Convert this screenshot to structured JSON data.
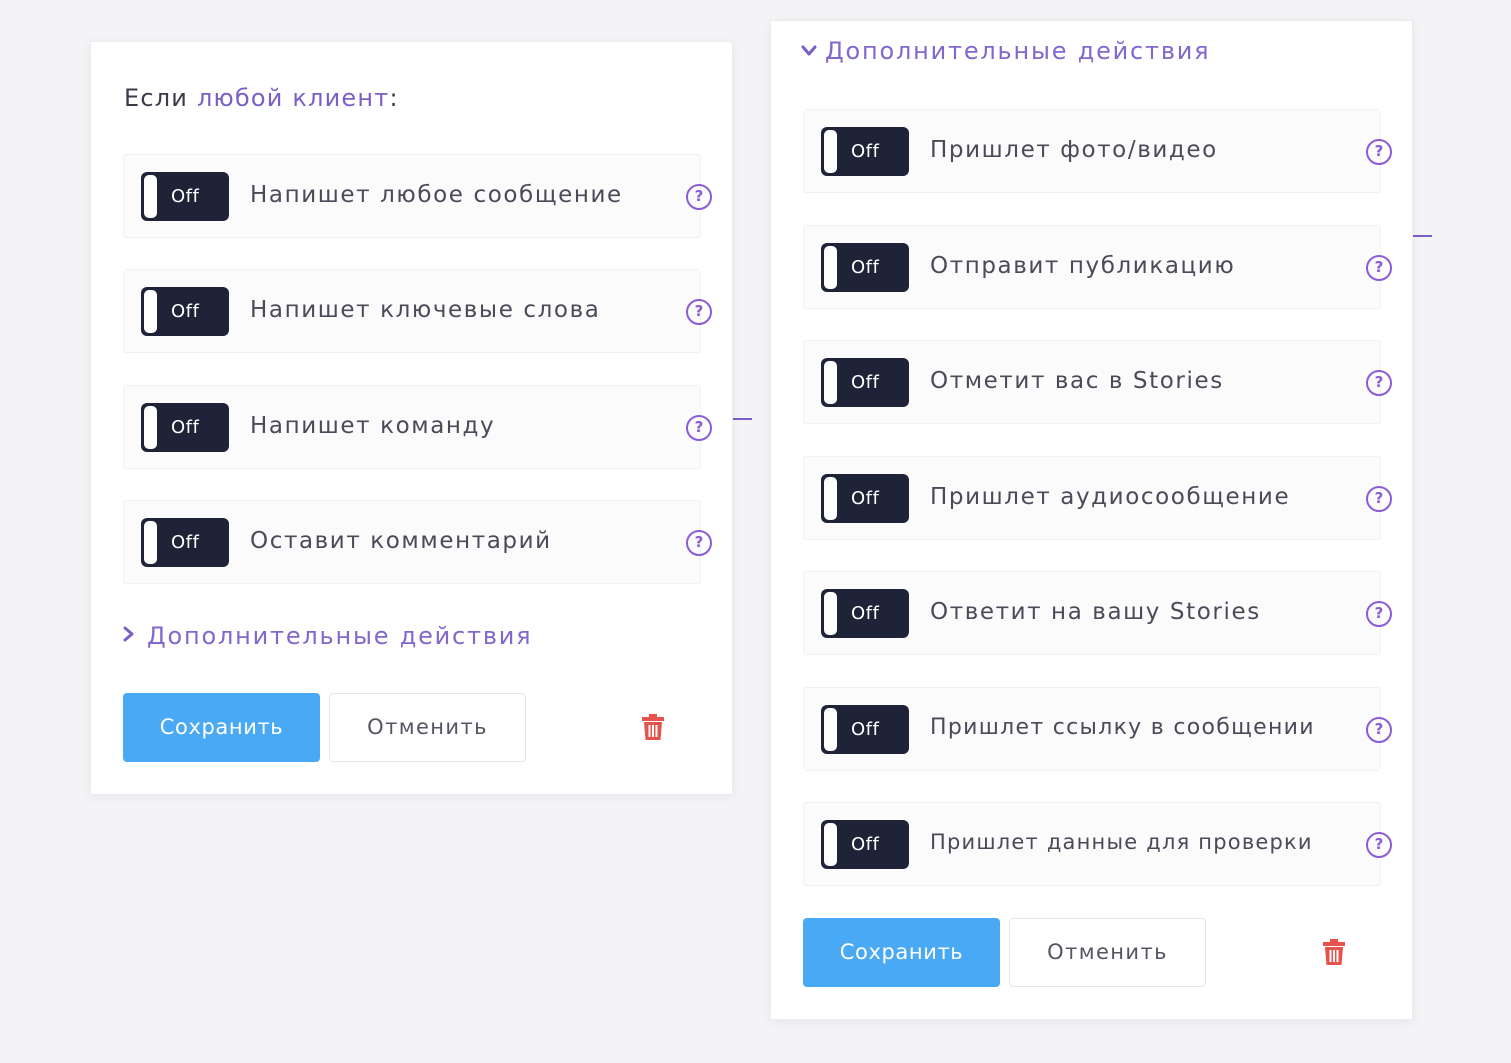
{
  "left_card": {
    "heading_prefix": "Если ",
    "heading_accent": "любой клиент",
    "heading_suffix": ":",
    "rows": [
      {
        "toggle": "Off",
        "label": "Напишет любое сообщение"
      },
      {
        "toggle": "Off",
        "label": "Напишет ключевые слова"
      },
      {
        "toggle": "Off",
        "label": "Напишет команду"
      },
      {
        "toggle": "Off",
        "label": "Оставит комментарий"
      }
    ],
    "more_actions": "Дополнительные действия",
    "save_label": "Сохранить",
    "cancel_label": "Отменить"
  },
  "right_card": {
    "more_actions": "Дополнительные действия",
    "rows": [
      {
        "toggle": "Off",
        "label": "Пришлет фото/видео"
      },
      {
        "toggle": "Off",
        "label": "Отправит публикацию"
      },
      {
        "toggle": "Off",
        "label": "Отметит вас в Stories"
      },
      {
        "toggle": "Off",
        "label": "Пришлет аудиосообщение"
      },
      {
        "toggle": "Off",
        "label": "Ответит на вашу Stories"
      },
      {
        "toggle": "Off",
        "label": "Пришлет ссылку в сообщении"
      },
      {
        "toggle": "Off",
        "label": "Пришлет данные для проверки"
      }
    ],
    "save_label": "Сохранить",
    "cancel_label": "Отменить"
  },
  "help_glyph": "?",
  "icons": {
    "toggle": "toggle-switch-icon",
    "help": "question-circle-icon",
    "chevron_right": "chevron-right-icon",
    "chevron_down": "chevron-down-icon",
    "trash": "trash-icon"
  },
  "colors": {
    "accent": "#7b5fc8",
    "toggle_bg": "#1f2337",
    "save_button": "#4aa9f4",
    "delete": "#e5534b"
  }
}
